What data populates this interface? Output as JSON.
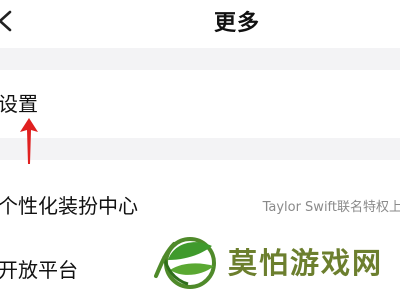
{
  "header": {
    "title": "更多",
    "back_icon": "chevron-left-icon"
  },
  "rows": {
    "settings": {
      "label": "设置"
    },
    "personalization": {
      "label": "个性化装扮中心",
      "value": "Taylor Swift联名特权上"
    },
    "open_platform": {
      "label": "开放平台"
    }
  },
  "annotation": {
    "arrow_icon": "red-up-arrow-icon",
    "arrow_color": "#e02020"
  },
  "watermark": {
    "logo_icon": "leaf-logo-icon",
    "text": "莫怕游戏网",
    "color": "#6c7f2e"
  },
  "colors": {
    "background": "#ffffff",
    "section_gap": "#f3f3f5",
    "secondary_text": "#8a8a8a"
  }
}
